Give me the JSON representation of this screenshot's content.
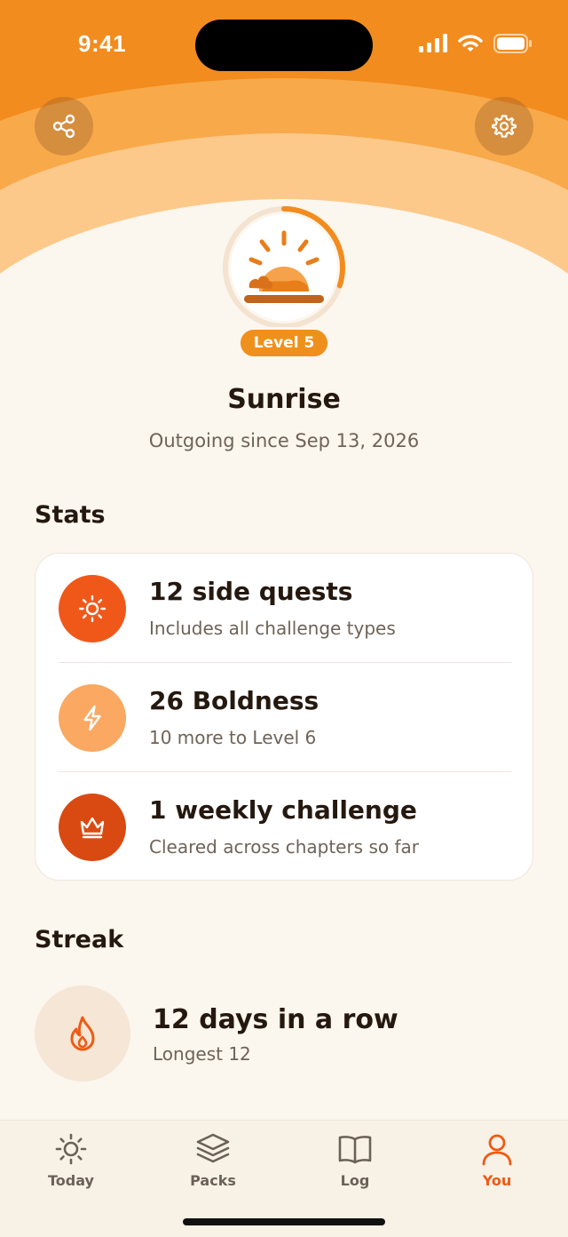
{
  "status_bar": {
    "time": "9:41"
  },
  "profile": {
    "level_label": "Level 5",
    "name": "Sunrise",
    "subtitle": "Outgoing since Sep 13, 2026",
    "level_progress": 0.3
  },
  "stats": {
    "section_title": "Stats",
    "items": [
      {
        "title": "12 side quests",
        "desc": "Includes all challenge types",
        "icon": "sun-icon",
        "color": "#F0581A"
      },
      {
        "title": "26 Boldness",
        "desc": "10 more to Level 6",
        "icon": "lightning-icon",
        "color": "#FAA862"
      },
      {
        "title": "1 weekly challenge",
        "desc": "Cleared across chapters so far",
        "icon": "crown-icon",
        "color": "#D94A12"
      }
    ]
  },
  "streak": {
    "section_title": "Streak",
    "title": "12 days in a row",
    "sub": "Longest 12",
    "icon": "flame-icon"
  },
  "tabs": [
    {
      "label": "Today",
      "icon": "sun-outline-icon",
      "active": false
    },
    {
      "label": "Packs",
      "icon": "layers-icon",
      "active": false
    },
    {
      "label": "Log",
      "icon": "book-icon",
      "active": false
    },
    {
      "label": "You",
      "icon": "person-icon",
      "active": true
    }
  ],
  "colors": {
    "accent": "#EE5A14",
    "header_dark": "#F28C1E",
    "header_mid": "#F8A94A",
    "header_light": "#FDC98A",
    "background": "#FBF6EE"
  }
}
